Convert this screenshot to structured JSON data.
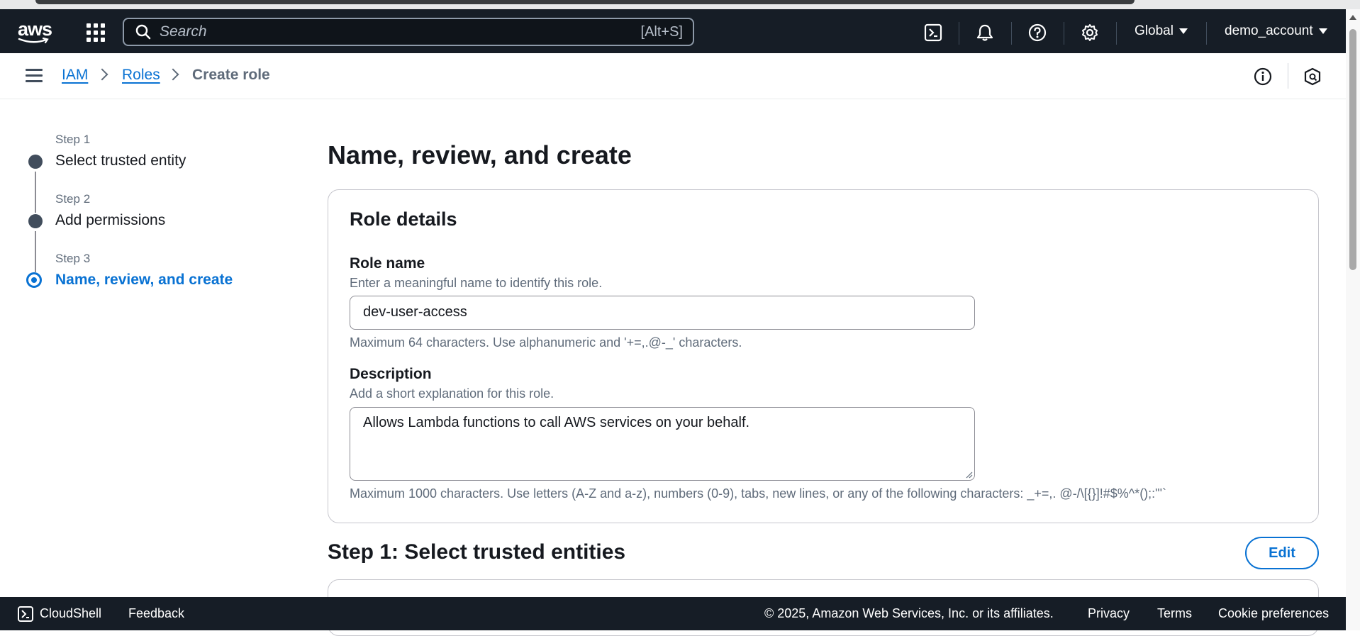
{
  "topnav": {
    "logo_text": "aws",
    "search_placeholder": "Search",
    "search_shortcut": "[Alt+S]",
    "region_label": "Global",
    "account_label": "demo_account"
  },
  "breadcrumb": {
    "items": [
      {
        "label": "IAM"
      },
      {
        "label": "Roles"
      },
      {
        "label": "Create role"
      }
    ]
  },
  "stepper": {
    "steps": [
      {
        "step": "Step 1",
        "title": "Select trusted entity"
      },
      {
        "step": "Step 2",
        "title": "Add permissions"
      },
      {
        "step": "Step 3",
        "title": "Name, review, and create"
      }
    ]
  },
  "main": {
    "page_title": "Name, review, and create",
    "role_details": {
      "title": "Role details",
      "role_name_label": "Role name",
      "role_name_desc": "Enter a meaningful name to identify this role.",
      "role_name_value": "dev-user-access",
      "role_name_hint": "Maximum 64 characters. Use alphanumeric and '+=,.@-_' characters.",
      "description_label": "Description",
      "description_desc": "Add a short explanation for this role.",
      "description_value": "Allows Lambda functions to call AWS services on your behalf.",
      "description_hint": "Maximum 1000 characters. Use letters (A-Z and a-z), numbers (0-9), tabs, new lines, or any of the following characters: _+=,. @-/\\[{}]!#$%^*();:\"'`"
    },
    "step1_title": "Step 1: Select trusted entities",
    "edit_label": "Edit"
  },
  "footer": {
    "cloudshell": "CloudShell",
    "feedback": "Feedback",
    "copyright": "© 2025, Amazon Web Services, Inc. or its affiliates.",
    "privacy": "Privacy",
    "terms": "Terms",
    "cookies": "Cookie preferences"
  },
  "colors": {
    "nav_bg": "#161d26",
    "link": "#0972d3",
    "text": "#16191f",
    "muted": "#5f6b7a"
  }
}
